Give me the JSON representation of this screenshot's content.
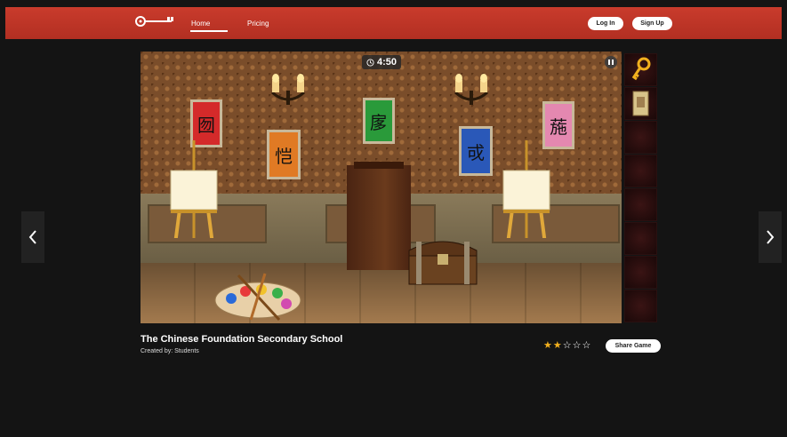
{
  "nav": {
    "home_label": "Home",
    "pricing_label": "Pricing",
    "login_label": "Log In",
    "signup_label": "Sign Up"
  },
  "game": {
    "timer": "4:50",
    "title": "The Chinese Foundation Secondary School",
    "creator": "Created by: Students",
    "rating": 2,
    "rating_max": 5,
    "share_label": "Share Game",
    "posters": [
      "囫",
      "恺",
      "扅",
      "戓",
      "葹"
    ]
  },
  "inventory": {
    "slots": [
      "key",
      "paper",
      "",
      "",
      "",
      "",
      "",
      ""
    ]
  },
  "colors": {
    "header": "#c93b2c",
    "star_filled": "#f2b01e",
    "background": "#141414"
  }
}
